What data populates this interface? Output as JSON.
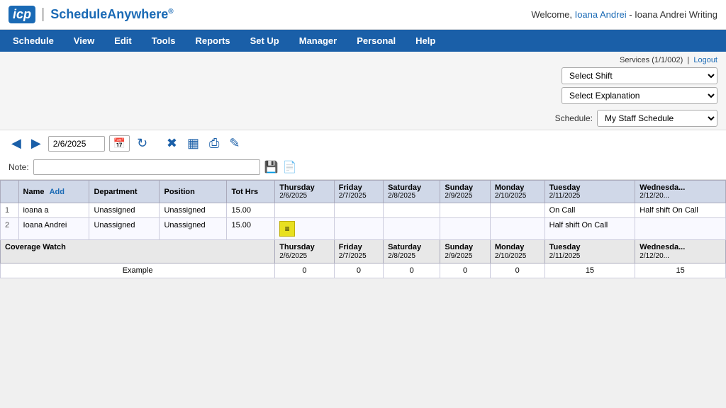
{
  "header": {
    "logo_icp": "icp",
    "logo_divider": "|",
    "logo_name": "ScheduleAnywhere",
    "logo_reg": "®",
    "welcome_text": "Welcome,",
    "user_link": "Ioana Andrei",
    "user_suffix": " - Ioana Andrei Writing",
    "services_text": "Services (1/1/002)",
    "logout_text": "Logout"
  },
  "nav": {
    "items": [
      "Schedule",
      "View",
      "Edit",
      "Tools",
      "Reports",
      "Set Up",
      "Manager",
      "Personal",
      "Help"
    ]
  },
  "filters": {
    "select_shift_label": "Select Shift",
    "select_explanation_label": "Select Explanation",
    "schedule_label": "Schedule:",
    "schedule_value": "My Staff Schedule"
  },
  "toolbar": {
    "date_value": "2/6/2025",
    "note_label": "Note:",
    "note_placeholder": ""
  },
  "table": {
    "headers": [
      {
        "label": "",
        "sub": ""
      },
      {
        "label": "Name",
        "sub": ""
      },
      {
        "label": "Department",
        "sub": ""
      },
      {
        "label": "Position",
        "sub": ""
      },
      {
        "label": "Tot Hrs",
        "sub": ""
      },
      {
        "label": "Thursday",
        "sub": "2/6/2025"
      },
      {
        "label": "Friday",
        "sub": "2/7/2025"
      },
      {
        "label": "Saturday",
        "sub": "2/8/2025"
      },
      {
        "label": "Sunday",
        "sub": "2/9/2025"
      },
      {
        "label": "Monday",
        "sub": "2/10/2025"
      },
      {
        "label": "Tuesday",
        "sub": "2/11/2025"
      },
      {
        "label": "Wednesday",
        "sub": "2/12/20..."
      }
    ],
    "rows": [
      {
        "num": "1",
        "name": "ioana a",
        "department": "Unassigned",
        "position": "Unassigned",
        "tot_hrs": "15.00",
        "thursday": "",
        "friday": "",
        "saturday": "",
        "sunday": "",
        "monday": "",
        "tuesday": "On Call",
        "wednesday": "Half shift On Call"
      },
      {
        "num": "2",
        "name": "Ioana Andrei",
        "department": "Unassigned",
        "position": "Unassigned",
        "tot_hrs": "15.00",
        "thursday": "icon",
        "friday": "",
        "saturday": "",
        "sunday": "",
        "monday": "",
        "tuesday": "Half shift On Call",
        "wednesday": ""
      }
    ],
    "coverage_header": "Coverage Watch",
    "coverage_row": {
      "thursday": "0",
      "friday": "0",
      "saturday": "0",
      "sunday": "0",
      "monday": "0",
      "tuesday": "15",
      "wednesday": "15"
    }
  }
}
